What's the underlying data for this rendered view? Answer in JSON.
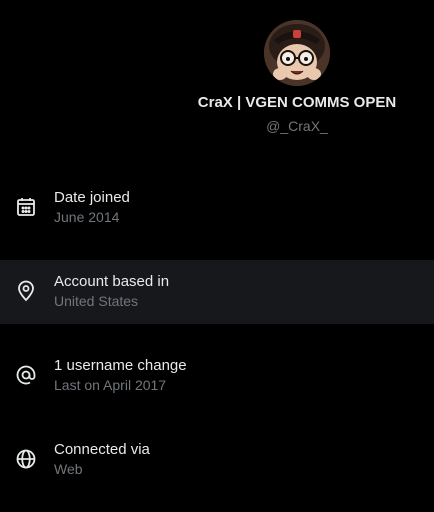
{
  "profile": {
    "display_name": "CraX | VGEN COMMS OPEN",
    "handle": "@_CraX_",
    "avatar_icon": "avatar-cartoon-glasses"
  },
  "colors": {
    "background": "#000000",
    "highlight_row": "#16181c",
    "primary_text": "#e7e9ea",
    "secondary_text": "#71767b"
  },
  "info_items": [
    {
      "icon": "calendar-icon",
      "title": "Date joined",
      "subtitle": "June 2014",
      "highlighted": false
    },
    {
      "icon": "location-pin-icon",
      "title": "Account based in",
      "subtitle": "United States",
      "highlighted": true
    },
    {
      "icon": "at-sign-icon",
      "title": "1 username change",
      "subtitle": "Last on April 2017",
      "highlighted": false
    },
    {
      "icon": "globe-icon",
      "title": "Connected via",
      "subtitle": "Web",
      "highlighted": false
    }
  ]
}
